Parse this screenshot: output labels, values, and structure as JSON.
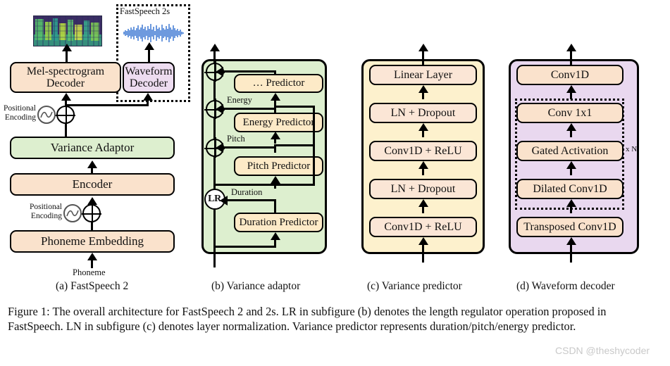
{
  "figure": {
    "caption": "Figure 1: The overall architecture for FastSpeech 2 and 2s. LR in subfigure (b) denotes the length regulator operation proposed in FastSpeech. LN in subfigure (c) denotes layer normalization. Variance predictor represents duration/pitch/energy predictor.",
    "watermark": "CSDN @theshycoder"
  },
  "subcaptions": {
    "a": "(a) FastSpeech 2",
    "b": "(b) Variance adaptor",
    "c": "(c) Variance predictor",
    "d": "(d) Waveform decoder"
  },
  "colors": {
    "peach_box": "#fae2cc",
    "cream_box": "#fdeac7",
    "lilac_box": "#eddcf0",
    "green_panel": "#ddefcf",
    "yellow_panel": "#fdf1cd",
    "purple_panel": "#e9d8ef",
    "pink_box": "#fbe6d6",
    "outline": "#000000",
    "waveform": "#2f6fd0",
    "watermark_text": "#c9c9c9"
  },
  "subfigure_a": {
    "group_label": "FastSpeech 2s",
    "input_label": "Phoneme",
    "positional_encoding_label": "Positional\nEncoding",
    "positional_encoding_line1": "Positional",
    "positional_encoding_line2": "Encoding",
    "blocks": [
      {
        "id": "phoneme-embedding",
        "label": "Phoneme Embedding",
        "color": "#fae2cc"
      },
      {
        "id": "encoder",
        "label": "Encoder",
        "color": "#fae2cc"
      },
      {
        "id": "variance-adaptor",
        "label": "Variance Adaptor",
        "color": "#ddefcf"
      },
      {
        "id": "mel-spectrogram-decoder",
        "label": "Mel-spectrogram\nDecoder",
        "line1": "Mel-spectrogram",
        "line2": "Decoder",
        "color": "#fae2cc"
      },
      {
        "id": "waveform-decoder",
        "label": "Waveform\nDecoder",
        "line1": "Waveform",
        "line2": "Decoder",
        "color": "#eddcf0"
      }
    ],
    "outputs": [
      {
        "id": "mel-spectrogram-image",
        "kind": "spectrogram"
      },
      {
        "id": "waveform-image",
        "kind": "waveform"
      }
    ]
  },
  "subfigure_b": {
    "panel_color": "#ddefcf",
    "blocks": [
      {
        "id": "duration-predictor",
        "label": "Duration Predictor"
      },
      {
        "id": "pitch-predictor",
        "label": "Pitch Predictor"
      },
      {
        "id": "energy-predictor",
        "label": "Energy Predictor"
      },
      {
        "id": "dots-predictor",
        "label": "… Predictor"
      }
    ],
    "edge_labels": [
      {
        "id": "duration-label",
        "label": "Duration"
      },
      {
        "id": "pitch-label",
        "label": "Pitch"
      },
      {
        "id": "energy-label",
        "label": "Energy"
      }
    ],
    "operators": [
      {
        "id": "length-regulator",
        "label": "LR"
      },
      {
        "id": "add-pitch",
        "label": "+"
      },
      {
        "id": "add-energy",
        "label": "+"
      },
      {
        "id": "add-other",
        "label": "+"
      }
    ]
  },
  "subfigure_c": {
    "panel_color": "#fdf1cd",
    "blocks": [
      {
        "id": "conv1d-relu-1",
        "label": "Conv1D + ReLU"
      },
      {
        "id": "ln-dropout-1",
        "label": "LN + Dropout"
      },
      {
        "id": "conv1d-relu-2",
        "label": "Conv1D + ReLU"
      },
      {
        "id": "ln-dropout-2",
        "label": "LN + Dropout"
      },
      {
        "id": "linear-layer",
        "label": "Linear Layer"
      }
    ]
  },
  "subfigure_d": {
    "panel_color": "#e9d8ef",
    "repeat_label": "x N",
    "blocks": [
      {
        "id": "transposed-conv1d",
        "label": "Transposed Conv1D"
      },
      {
        "id": "dilated-conv1d",
        "label": "Dilated Conv1D"
      },
      {
        "id": "gated-activation",
        "label": "Gated Activation"
      },
      {
        "id": "conv-1x1",
        "label": "Conv 1x1"
      },
      {
        "id": "conv1d-out",
        "label": "Conv1D"
      }
    ]
  }
}
